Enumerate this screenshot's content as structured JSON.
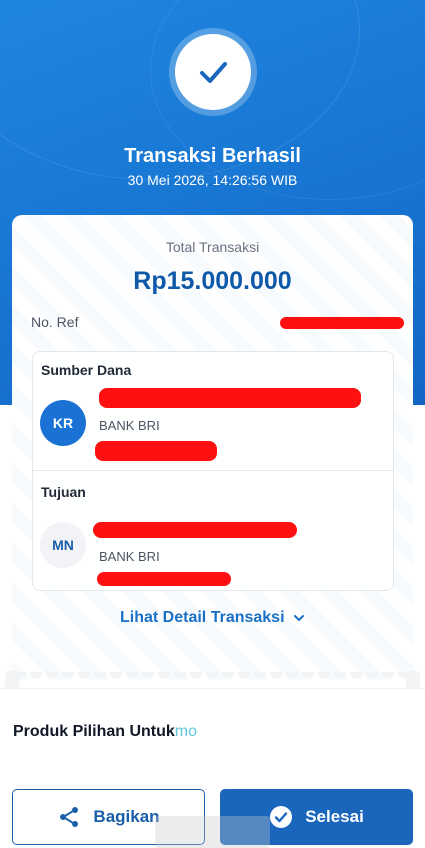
{
  "header": {
    "title": "Transaksi Berhasil",
    "datetime": "30 Mei 2026, 14:26:56 WIB",
    "status_icon": "check-icon"
  },
  "summary": {
    "total_label": "Total Transaksi",
    "total_amount": "Rp15.000.000",
    "ref_label": "No. Ref"
  },
  "source": {
    "section_title": "Sumber Dana",
    "initials": "KR",
    "bank": "BANK BRI"
  },
  "destination": {
    "section_title": "Tujuan",
    "initials": "MN",
    "bank": "BANK BRI"
  },
  "detail_link": "Lihat Detail Transaksi",
  "promo": {
    "title": "Produk Pilihan Untuk",
    "brand": "mo"
  },
  "footer": {
    "share_label": "Bagikan",
    "done_label": "Selesai"
  },
  "colors": {
    "header_blue": "#1673cf",
    "amount_blue": "#0f5aa8",
    "button_blue": "#1a66bd",
    "redaction_red": "#ff1010"
  }
}
